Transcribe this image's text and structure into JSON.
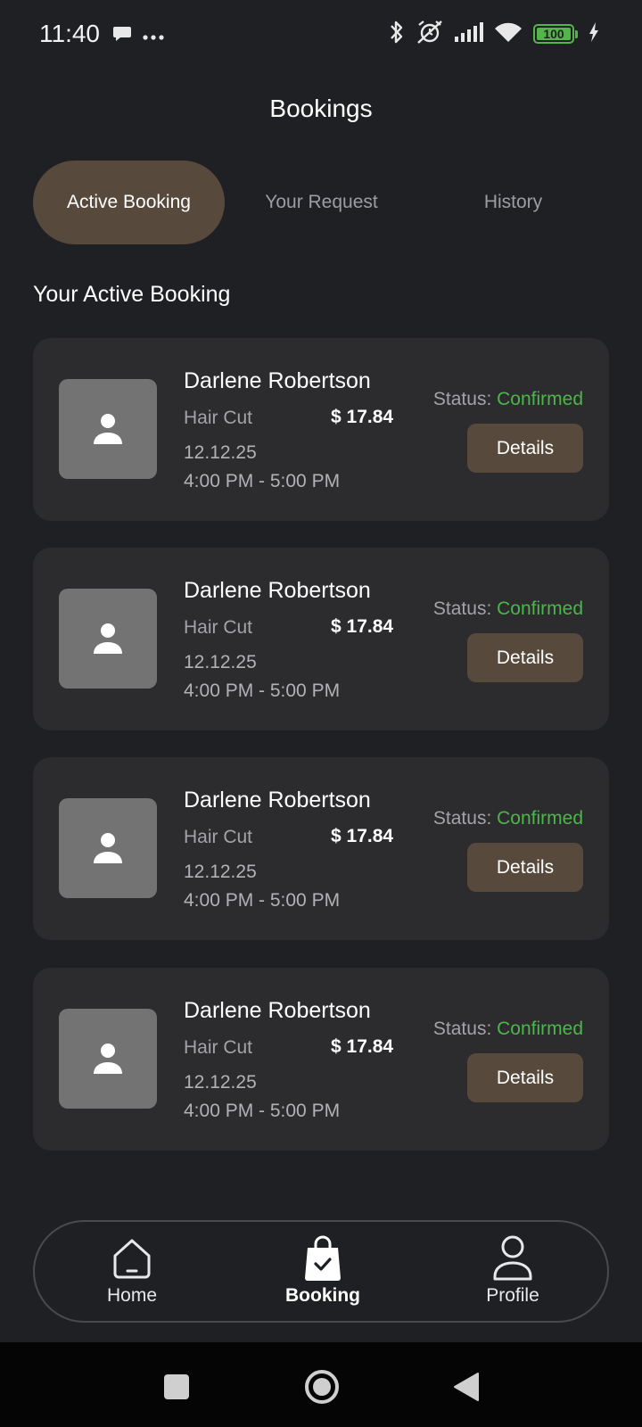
{
  "status_bar": {
    "time": "11:40",
    "battery": "100",
    "icons": [
      "chat-bubble-icon",
      "more-dots-icon",
      "bluetooth-icon",
      "alarm-off-icon",
      "signal-icon",
      "wifi-icon",
      "battery-icon",
      "charging-bolt-icon"
    ],
    "accent": "#54b54a"
  },
  "header": {
    "title": "Bookings"
  },
  "tabs": [
    {
      "label": "Active Booking",
      "active": true
    },
    {
      "label": "Your Request",
      "active": false
    },
    {
      "label": "History",
      "active": false
    }
  ],
  "section_title": "Your Active Booking",
  "bookings": [
    {
      "name": "Darlene Robertson",
      "service": "Hair Cut",
      "price": "$ 17.84",
      "date": "12.12.25",
      "time": "4:00 PM - 5:00 PM",
      "status_label": "Status:",
      "status_value": "Confirmed",
      "details_label": "Details"
    },
    {
      "name": "Darlene Robertson",
      "service": "Hair Cut",
      "price": "$ 17.84",
      "date": "12.12.25",
      "time": "4:00 PM - 5:00 PM",
      "status_label": "Status:",
      "status_value": "Confirmed",
      "details_label": "Details"
    },
    {
      "name": "Darlene Robertson",
      "service": "Hair Cut",
      "price": "$ 17.84",
      "date": "12.12.25",
      "time": "4:00 PM - 5:00 PM",
      "status_label": "Status:",
      "status_value": "Confirmed",
      "details_label": "Details"
    },
    {
      "name": "Darlene Robertson",
      "service": "Hair Cut",
      "price": "$ 17.84",
      "date": "12.12.25",
      "time": "4:00 PM - 5:00 PM",
      "status_label": "Status:",
      "status_value": "Confirmed",
      "details_label": "Details"
    }
  ],
  "bottom_nav": {
    "items": [
      {
        "label": "Home",
        "icon": "home-icon",
        "active": false
      },
      {
        "label": "Booking",
        "icon": "shopping-bag-check-icon",
        "active": true
      },
      {
        "label": "Profile",
        "icon": "profile-icon",
        "active": false
      }
    ]
  },
  "colors": {
    "background": "#1f2024",
    "card": "#2c2c2f",
    "accent_brown": "#574a3d",
    "status_green": "#4cb64a"
  }
}
